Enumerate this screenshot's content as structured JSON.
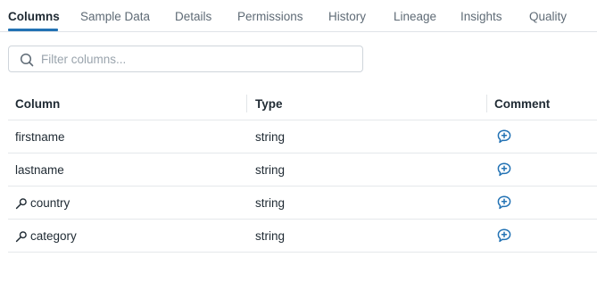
{
  "tabs": [
    {
      "label": "Columns",
      "active": true
    },
    {
      "label": "Sample Data",
      "active": false
    },
    {
      "label": "Details",
      "active": false
    },
    {
      "label": "Permissions",
      "active": false
    },
    {
      "label": "History",
      "active": false
    },
    {
      "label": "Lineage",
      "active": false
    },
    {
      "label": "Insights",
      "active": false
    },
    {
      "label": "Quality",
      "active": false
    }
  ],
  "filter": {
    "placeholder": "Filter columns...",
    "value": ""
  },
  "table": {
    "headers": {
      "column": "Column",
      "type": "Type",
      "comment": "Comment"
    },
    "rows": [
      {
        "name": "firstname",
        "type": "string",
        "key_icon": false
      },
      {
        "name": "lastname",
        "type": "string",
        "key_icon": false
      },
      {
        "name": "country",
        "type": "string",
        "key_icon": true
      },
      {
        "name": "category",
        "type": "string",
        "key_icon": true
      }
    ]
  },
  "colors": {
    "accent": "#2272b4",
    "text": "#1f2a33",
    "muted": "#5f6b76",
    "border": "#e5e8eb"
  },
  "icons": {
    "search": "search-icon",
    "key": "key-icon",
    "comment": "add-comment-icon"
  }
}
